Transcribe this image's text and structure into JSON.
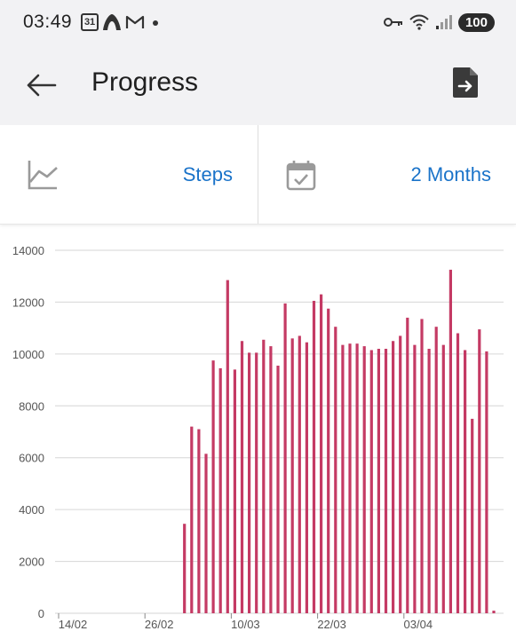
{
  "status_bar": {
    "time": "03:49",
    "calendar_day": "31",
    "battery": "100",
    "icons": [
      "calendar-icon",
      "app-icon",
      "gmail-icon",
      "dot-icon",
      "vpn-key-icon",
      "wifi-icon",
      "signal-icon"
    ]
  },
  "app_bar": {
    "title": "Progress",
    "back_icon": "arrow-back-icon",
    "export_icon": "export-file-icon"
  },
  "selectors": {
    "metric_label": "Steps",
    "metric_icon": "line-chart-icon",
    "period_label": "2 Months",
    "period_icon": "calendar-check-icon"
  },
  "colors": {
    "bar": "#c43a64",
    "accent": "#1a73c9",
    "grid": "#d6d6d6"
  },
  "chart_data": {
    "type": "bar",
    "ylim": [
      0,
      14000
    ],
    "yticks": [
      "0",
      "2000",
      "4000",
      "6000",
      "8000",
      "10000",
      "12000",
      "14000"
    ],
    "xtick_labels": [
      "14/02",
      "26/02",
      "10/03",
      "22/03",
      "03/04"
    ],
    "xtick_index": [
      0,
      12,
      24,
      36,
      48
    ],
    "grid": true,
    "values": [
      0,
      0,
      0,
      0,
      0,
      0,
      0,
      0,
      0,
      0,
      0,
      0,
      0,
      0,
      0,
      0,
      0,
      3450,
      7200,
      7100,
      6150,
      9750,
      9450,
      12850,
      9400,
      10500,
      10050,
      10050,
      10550,
      10300,
      9550,
      11950,
      10600,
      10700,
      10450,
      12050,
      12300,
      11750,
      11050,
      10350,
      10400,
      10400,
      10300,
      10150,
      10200,
      10200,
      10500,
      10700,
      11400,
      10350,
      11350,
      10200,
      11050,
      10350,
      13250,
      10800,
      10150,
      7500,
      10950,
      10100,
      100
    ]
  }
}
